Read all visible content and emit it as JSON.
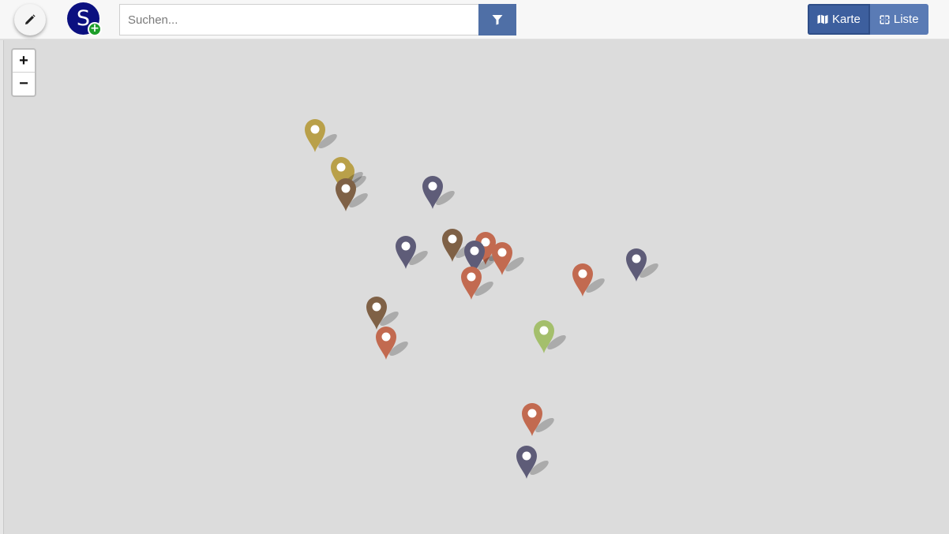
{
  "toolbar": {
    "edit_icon": "pencil-icon",
    "avatar_letter": "S",
    "avatar_badge": "+",
    "search_placeholder": "Suchen...",
    "search_value": "",
    "filter_icon": "filter-funnel-icon"
  },
  "view_toggle": {
    "map_label": "Karte",
    "map_icon": "map-icon",
    "list_label": "Liste",
    "list_icon": "grid-list-icon",
    "active": "Karte"
  },
  "map": {
    "zoom_in": "+",
    "zoom_out": "−"
  },
  "colors": {
    "gold": "#b9a049",
    "brown": "#7f6146",
    "slate": "#5e5c78",
    "terracotta": "#c26a50",
    "green": "#a4bf6c",
    "accent": "#4f6fa6",
    "avatar": "#0b1080"
  },
  "markers": [
    {
      "color": "gold"
    },
    {
      "color": "gold"
    },
    {
      "color": "gold"
    },
    {
      "color": "brown"
    },
    {
      "color": "slate"
    },
    {
      "color": "slate"
    },
    {
      "color": "brown"
    },
    {
      "color": "terracotta"
    },
    {
      "color": "slate"
    },
    {
      "color": "terracotta"
    },
    {
      "color": "terracotta"
    },
    {
      "color": "terracotta"
    },
    {
      "color": "slate"
    },
    {
      "color": "brown"
    },
    {
      "color": "terracotta"
    },
    {
      "color": "green"
    },
    {
      "color": "terracotta"
    },
    {
      "color": "slate"
    }
  ]
}
